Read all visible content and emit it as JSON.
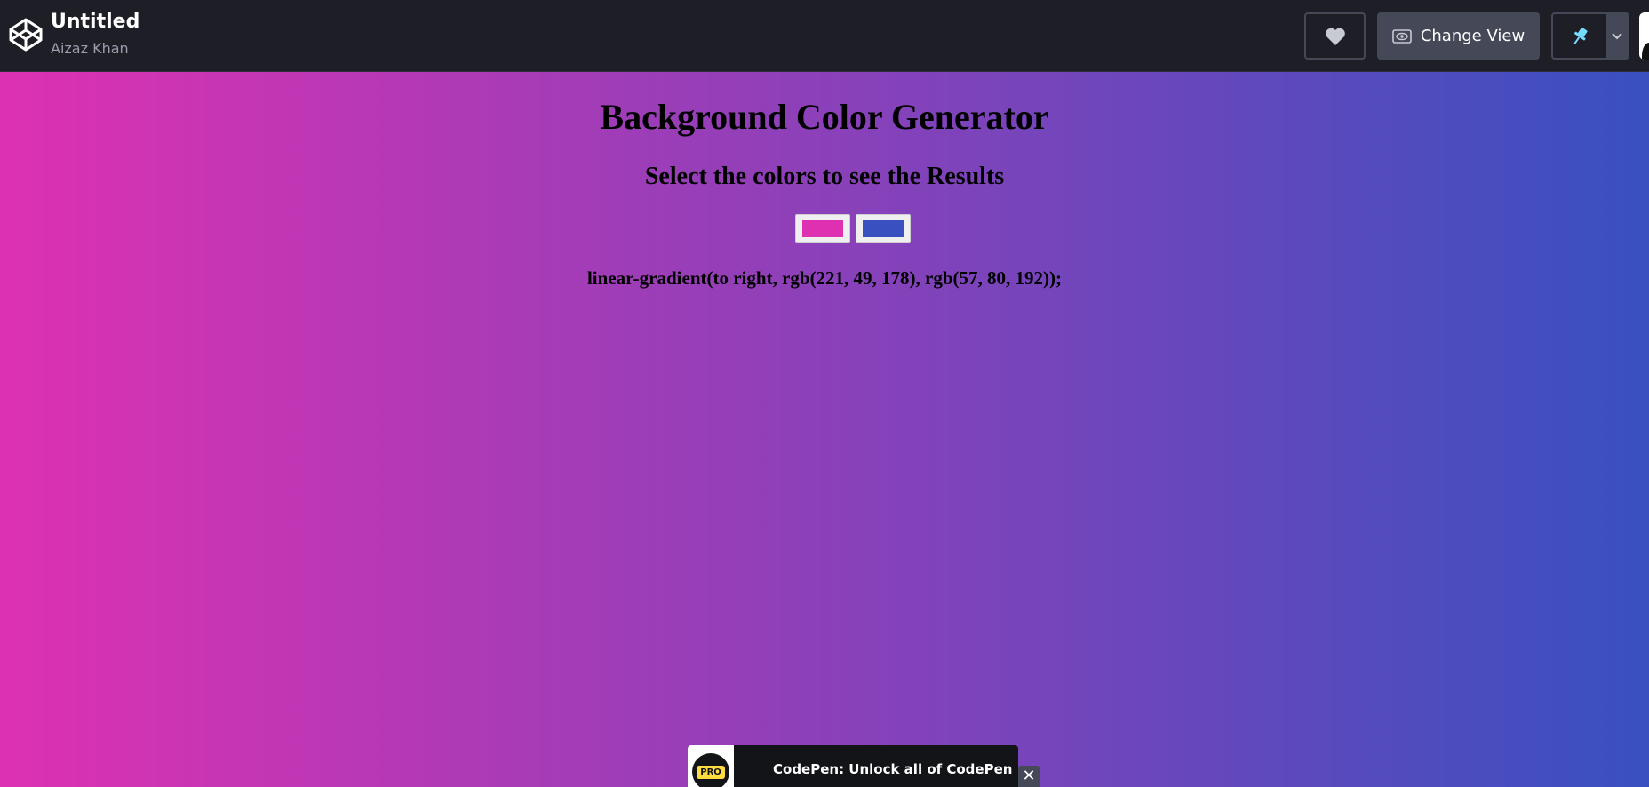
{
  "header": {
    "title": "Untitled",
    "author": "Aizaz Khan",
    "change_view_label": "Change View",
    "icons": [
      "codepen-logo-icon",
      "heart-icon",
      "eye-icon",
      "pin-icon",
      "chevron-down-icon"
    ]
  },
  "preview": {
    "heading": "Background Color Generator",
    "subheading": "Select the colors to see the Results",
    "color1": "#dd31b2",
    "color2": "#3950c0",
    "css_text": "linear-gradient(to right, rgb(221, 49, 178), rgb(57, 80, 192));"
  },
  "banner": {
    "badge": "PRO",
    "text": "CodePen: Unlock all of CodePen",
    "close": "✕"
  },
  "colors": {
    "topbar_bg": "#1e1f26",
    "button_bg": "#444857",
    "pin_accent": "#76daff",
    "pro_yellow": "#ffdd40"
  }
}
